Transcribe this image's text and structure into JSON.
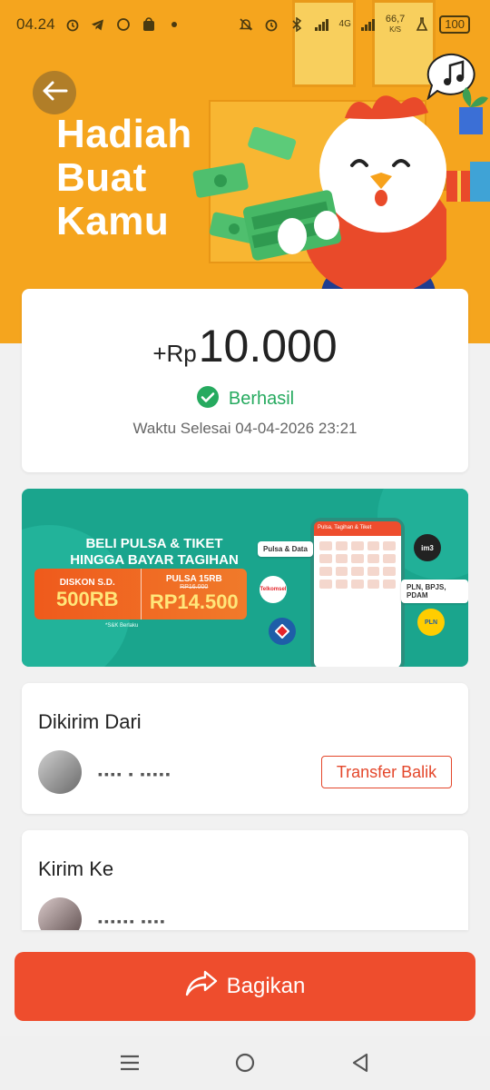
{
  "status_bar": {
    "time": "04.24",
    "network_speed_value": "66,7",
    "network_speed_unit": "K/S",
    "network_type": "4G",
    "battery": "100"
  },
  "hero": {
    "title_lines": [
      "Hadiah",
      "Buat",
      "Kamu"
    ]
  },
  "transaction": {
    "currency_prefix": "+Rp",
    "amount": "10.000",
    "status": "Berhasil",
    "completed_time": "Waktu Selesai 04-04-2026 23:21"
  },
  "promo": {
    "headline_1": "BELI PULSA & TIKET",
    "headline_2": "HINGGA BAYAR TAGIHAN",
    "discount_label": "DISKON S.D.",
    "discount_value": "500RB",
    "pulsa_label": "PULSA 15RB",
    "pulsa_original": "RP16.000",
    "pulsa_price": "RP14.500",
    "footnote": "*S&K Berlaku",
    "phone_title": "Pulsa, Tagihan & Tiket",
    "pill_left": "Pulsa & Data",
    "pill_right": "PLN, BPJS, PDAM",
    "logo_im3": "im3",
    "logo_pln": "PLN",
    "logo_telkomsel": "Telkomsel"
  },
  "sender": {
    "section_title": "Dikirim Dari",
    "masked_name": "▪▪▪▪ ▪ ▪▪▪▪▪",
    "transfer_back_label": "Transfer Balik"
  },
  "receiver": {
    "section_title": "Kirim Ke",
    "masked_name": "▪▪▪▪▪▪ ▪▪▪▪"
  },
  "share": {
    "label": "Bagikan"
  },
  "colors": {
    "brand": "#ee4d2d",
    "success": "#26aa5f",
    "hero_bg": "#f5a51e",
    "promo_bg": "#1aa58d"
  },
  "icons": [
    "back-arrow-icon",
    "check-circle-icon",
    "share-arrow-icon",
    "menu-icon",
    "home-icon",
    "back-icon"
  ]
}
